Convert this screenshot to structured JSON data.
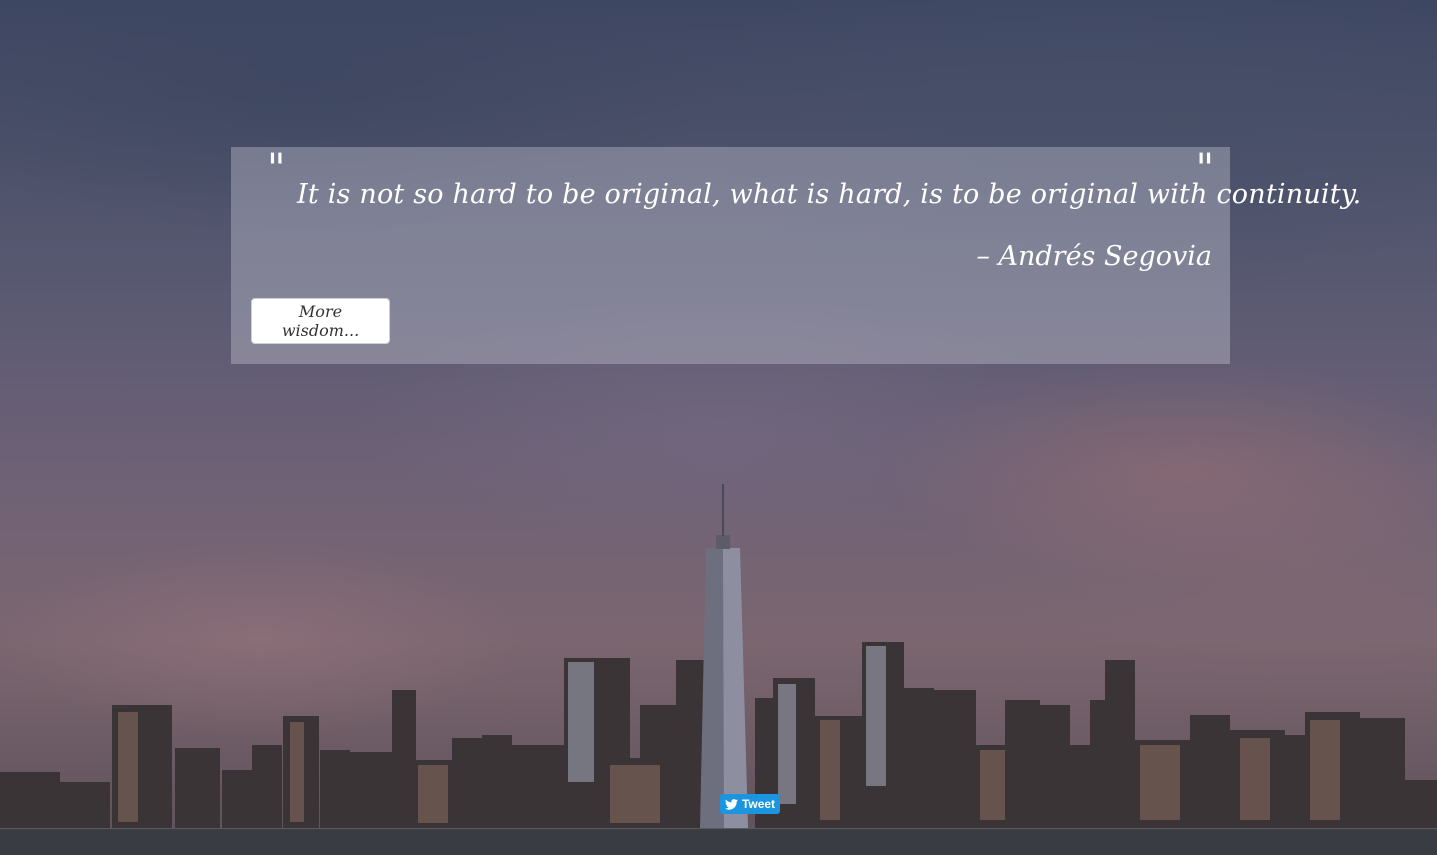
{
  "quote": {
    "open_mark": "\"",
    "close_mark": "\"",
    "text": "It is not so hard to be original, what is hard, is to be original with continuity.",
    "author": "– Andrés Segovia"
  },
  "actions": {
    "more_label": "More wisdom...",
    "tweet_label": "Tweet"
  },
  "icons": {
    "tweet": "twitter-bird-icon"
  },
  "colors": {
    "tweet_button": "#1b95e0",
    "quote_text": "#ffffff",
    "quote_panel": "rgba(190,190,205,0.42)"
  }
}
